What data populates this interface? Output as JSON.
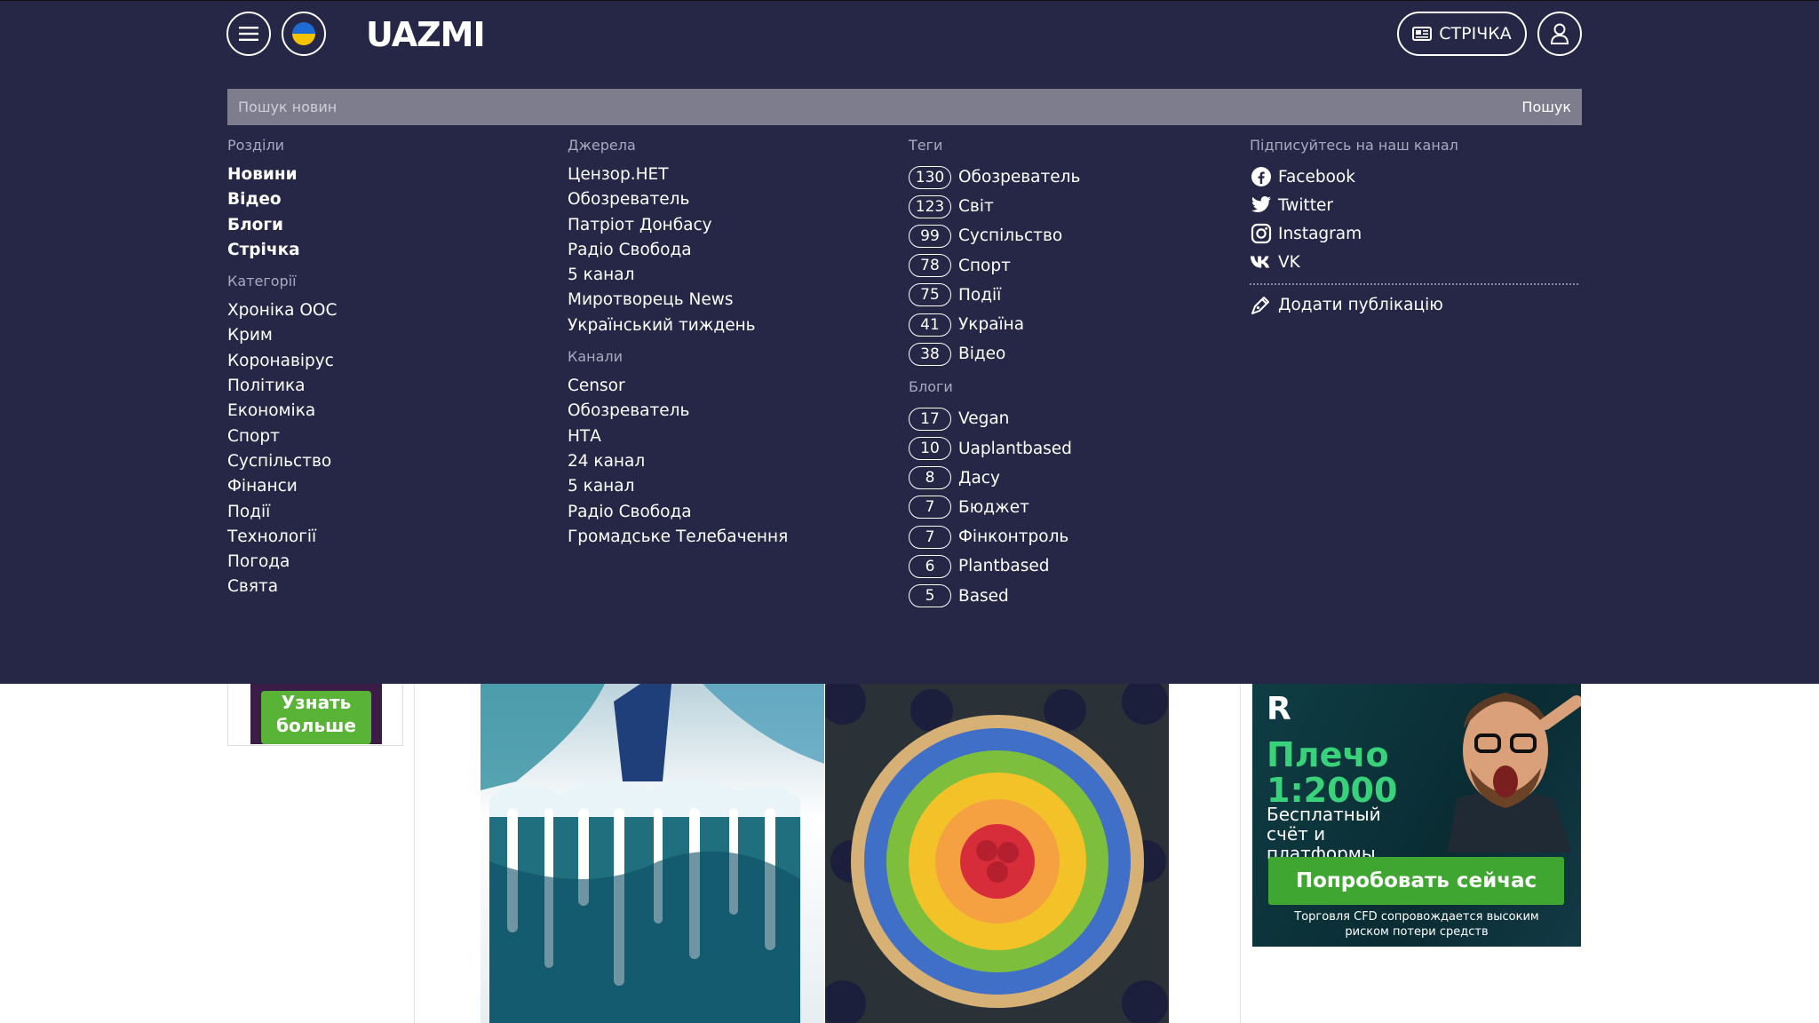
{
  "header": {
    "logo": "UAZMI",
    "feed_label": "СТРІЧКА"
  },
  "search": {
    "placeholder": "Пошук новин",
    "button": "Пошук"
  },
  "sections": {
    "heading": "Розділи",
    "items": [
      "Новини",
      "Відео",
      "Блоги",
      "Стрічка"
    ]
  },
  "categories": {
    "heading": "Категорії",
    "items": [
      "Хроніка ООС",
      "Крим",
      "Коронавірус",
      "Політика",
      "Економіка",
      "Спорт",
      "Суспільство",
      "Фінанси",
      "Події",
      "Технології",
      "Погода",
      "Свята"
    ]
  },
  "sources": {
    "heading": "Джерела",
    "items": [
      "Цензор.НЕТ",
      "Обозреватель",
      "Патріот Донбасу",
      "Радіо Свобода",
      "5 канал",
      "Миротворець News",
      "Український тиждень"
    ]
  },
  "channels": {
    "heading": "Канали",
    "items": [
      "Censor",
      "Обозреватель",
      "НТА",
      "24 канал",
      "5 канал",
      "Радіо Свобода",
      "Громадське Телебачення"
    ]
  },
  "tags": {
    "heading": "Теги",
    "items": [
      {
        "count": "130",
        "name": "Обозреватель"
      },
      {
        "count": "123",
        "name": "Світ"
      },
      {
        "count": "99",
        "name": "Суспільство"
      },
      {
        "count": "78",
        "name": "Спорт"
      },
      {
        "count": "75",
        "name": "Події"
      },
      {
        "count": "41",
        "name": "Україна"
      },
      {
        "count": "38",
        "name": "Відео"
      }
    ]
  },
  "blogs": {
    "heading": "Блоги",
    "items": [
      {
        "count": "17",
        "name": "Vegan"
      },
      {
        "count": "10",
        "name": "Uaplantbased"
      },
      {
        "count": "8",
        "name": "Дасу"
      },
      {
        "count": "7",
        "name": "Бюджет"
      },
      {
        "count": "7",
        "name": "Фінконтроль"
      },
      {
        "count": "6",
        "name": "Plantbased"
      },
      {
        "count": "5",
        "name": "Based"
      }
    ]
  },
  "social": {
    "heading": "Підписуйтесь на наш канал",
    "items": [
      {
        "icon": "facebook-icon",
        "label": "Facebook"
      },
      {
        "icon": "twitter-icon",
        "label": "Twitter"
      },
      {
        "icon": "instagram-icon",
        "label": "Instagram"
      },
      {
        "icon": "vk-icon",
        "label": "VK"
      }
    ],
    "add_publication": "Додати публікацію"
  },
  "ads": {
    "side_button": "Узнать больше",
    "banner_brand": "R",
    "banner_headline": "Плечо 1:2000",
    "banner_sub": "Бесплатный счёт и платформы",
    "banner_cta": "Попробовать сейчас",
    "banner_disclaimer": "Торговля CFD сопровождается высоким риском потери средств"
  },
  "colors": {
    "menu_bg": "#262646",
    "search_bg": "#7d7d8e",
    "muted_heading": "#a9a9c0",
    "ad_green": "#3fa631"
  }
}
